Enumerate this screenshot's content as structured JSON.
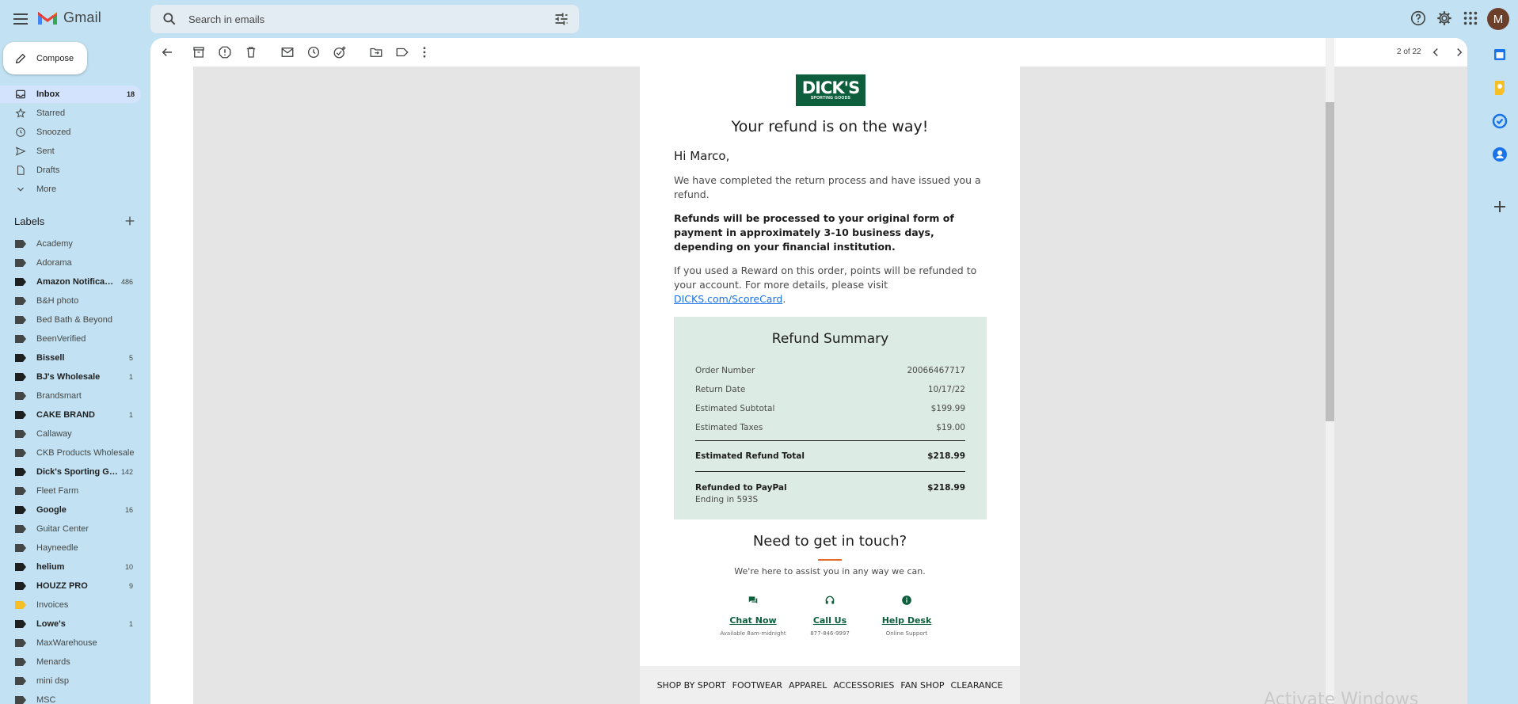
{
  "app": {
    "name": "Gmail",
    "avatar_letter": "M"
  },
  "search": {
    "placeholder": "Search in emails"
  },
  "compose_label": "Compose",
  "nav": [
    {
      "label": "Inbox",
      "count": "18"
    },
    {
      "label": "Starred",
      "count": ""
    },
    {
      "label": "Snoozed",
      "count": ""
    },
    {
      "label": "Sent",
      "count": ""
    },
    {
      "label": "Drafts",
      "count": ""
    },
    {
      "label": "More",
      "count": ""
    }
  ],
  "labels_header": "Labels",
  "labels": [
    {
      "label": "Academy",
      "count": ""
    },
    {
      "label": "Adorama",
      "count": ""
    },
    {
      "label": "Amazon Notifica…",
      "count": "486"
    },
    {
      "label": "B&H photo",
      "count": ""
    },
    {
      "label": "Bed Bath & Beyond",
      "count": ""
    },
    {
      "label": "BeenVerified",
      "count": ""
    },
    {
      "label": "Bissell",
      "count": "5"
    },
    {
      "label": "BJ's Wholesale",
      "count": "1"
    },
    {
      "label": "Brandsmart",
      "count": ""
    },
    {
      "label": "CAKE BRAND",
      "count": "1"
    },
    {
      "label": "Callaway",
      "count": ""
    },
    {
      "label": "CKB Products Wholesale",
      "count": ""
    },
    {
      "label": "Dick's Sporting G…",
      "count": "142"
    },
    {
      "label": "Fleet Farm",
      "count": ""
    },
    {
      "label": "Google",
      "count": "16"
    },
    {
      "label": "Guitar Center",
      "count": ""
    },
    {
      "label": "Hayneedle",
      "count": ""
    },
    {
      "label": "helium",
      "count": "10"
    },
    {
      "label": "HOUZZ PRO",
      "count": "9"
    },
    {
      "label": "Invoices",
      "count": ""
    },
    {
      "label": "Lowe's",
      "count": "1"
    },
    {
      "label": "MaxWarehouse",
      "count": ""
    },
    {
      "label": "Menards",
      "count": ""
    },
    {
      "label": "mini dsp",
      "count": ""
    },
    {
      "label": "MSC",
      "count": ""
    }
  ],
  "pager": {
    "text": "2 of 22"
  },
  "email": {
    "logo_big": "DICK'S",
    "logo_small": "SPORTING GOODS",
    "title": "Your refund is on the way!",
    "greeting": "Hi Marco,",
    "p1": "We have completed the return process and have issued you a refund.",
    "p2": "Refunds will be processed to your original form of payment in approximately 3-10 business days, depending on your financial institution.",
    "p3_pre": "If you used a Reward on this order, points will be refunded to your account. For more details, please visit ",
    "p3_link": "DICKS.com/ScoreCard",
    "p3_post": ".",
    "summary": {
      "title": "Refund Summary",
      "rows": [
        {
          "k": "Order Number",
          "v": "20066467717"
        },
        {
          "k": "Return Date",
          "v": "10/17/22"
        },
        {
          "k": "Estimated Subtotal",
          "v": "$199.99"
        },
        {
          "k": "Estimated Taxes",
          "v": "$19.00"
        }
      ],
      "total": {
        "k": "Estimated Refund Total",
        "v": "$218.99"
      },
      "refunded": {
        "k": "Refunded to PayPal",
        "v": "$218.99"
      },
      "ending": "Ending in 593S"
    },
    "touch_title": "Need to get in touch?",
    "touch_sub": "We're here to assist you in any way we can.",
    "contacts": [
      {
        "label": "Chat Now",
        "sub": "Available 8am-midnight"
      },
      {
        "label": "Call Us",
        "sub": "877-846-9997"
      },
      {
        "label": "Help Desk",
        "sub": "Online Support"
      }
    ],
    "footer": [
      "SHOP BY SPORT",
      "FOOTWEAR",
      "APPAREL",
      "ACCESSORIES",
      "FAN SHOP",
      "CLEARANCE"
    ]
  },
  "watermark": "Activate Windows",
  "colors": {
    "brand_green": "#0d5e3c",
    "accent_orange": "#e46a2a",
    "link_blue": "#1a73e8",
    "active_nav": "#d3e3fd",
    "invoices_tag": "#f6bf26"
  }
}
